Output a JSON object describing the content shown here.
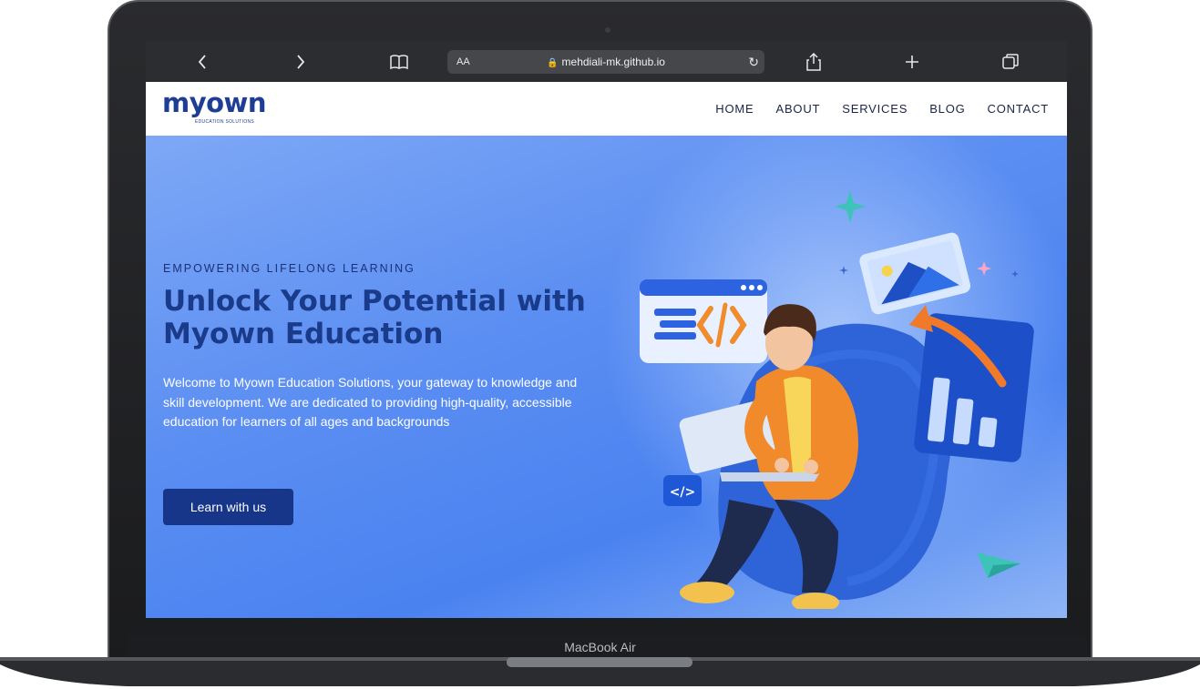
{
  "device": {
    "label": "MacBook Air"
  },
  "browser": {
    "aa_label": "AA",
    "url": "mehdiali-mk.github.io",
    "icons": [
      "chevron-left-icon",
      "chevron-right-icon",
      "book-icon",
      "lock-icon",
      "reload-icon",
      "share-icon",
      "plus-icon",
      "tabs-icon"
    ]
  },
  "site": {
    "logo": {
      "main": "myown",
      "sub": "EDUCATION SOLUTIONS"
    },
    "nav": [
      "HOME",
      "ABOUT",
      "SERVICES",
      "BLOG",
      "CONTACT"
    ]
  },
  "hero": {
    "eyebrow": "EMPOWERING LIFELONG LEARNING",
    "title": "Unlock Your Potential with Myown Education",
    "description": "Welcome to Myown Education Solutions, your gateway to knowledge and skill development. We are dedicated to providing high-quality, accessible education for learners of all ages and backgrounds",
    "cta_label": "Learn with us",
    "code_badge": "</>"
  },
  "colors": {
    "brand": "#1e3e96",
    "cta": "#17368a",
    "hero_bg": "#5b8ef2",
    "safari_bar": "#2c2d30"
  }
}
